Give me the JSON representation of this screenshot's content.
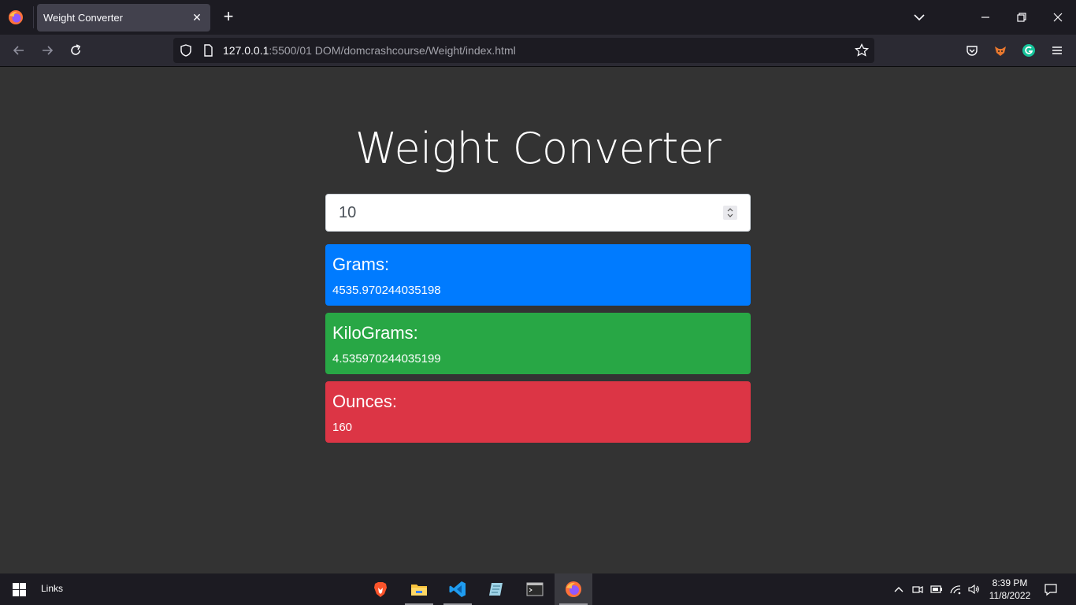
{
  "browser": {
    "tab_title": "Weight Converter",
    "url_host": "127.0.0.1",
    "url_rest": ":5500/01 DOM/domcrashcourse/Weight/index.html"
  },
  "page": {
    "title": "Weight Converter",
    "input_value": "10",
    "cards": [
      {
        "label": "Grams:",
        "value": "4535.970244035198",
        "color": "#007bff"
      },
      {
        "label": "KiloGrams:",
        "value": "4.535970244035199",
        "color": "#28a745"
      },
      {
        "label": "Ounces:",
        "value": "160",
        "color": "#dc3545"
      }
    ]
  },
  "taskbar": {
    "links_label": "Links",
    "apps": [
      "brave-icon",
      "file-explorer-icon",
      "vscode-icon",
      "notes-icon",
      "terminal-icon",
      "firefox-icon"
    ],
    "time": "8:39 PM",
    "date": "11/8/2022"
  }
}
